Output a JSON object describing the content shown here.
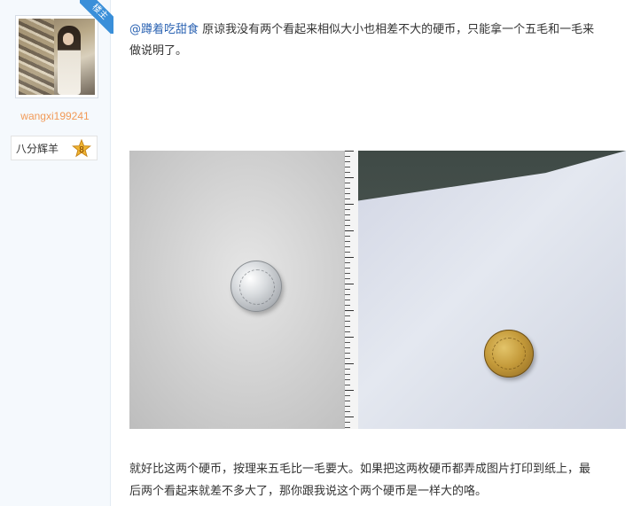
{
  "sidebar": {
    "username": "wangxi199241",
    "badge": "楼主",
    "rank": {
      "label": "八分辉羊",
      "level": "8"
    }
  },
  "post": {
    "mention": "@蹲着吃甜食",
    "line1": " 原谅我没有两个看起来相似大小也相差不大的硬币，只能拿一个五毛和一毛来",
    "line2": "做说明了。",
    "line3": "就好比这两个硬币，按理来五毛比一毛要大。如果把这两枚硬币都弄成图片打印到纸上，最",
    "line4": "后两个看起来就差不多大了，那你跟我说这个两个硬币是一样大的咯。"
  },
  "colors": {
    "mention": "#2d64b3",
    "username": "#f29a57",
    "badge": "#3a8fd9",
    "star": "#f0b531"
  },
  "icons": {
    "avatar": "avatar",
    "star": "star-icon"
  }
}
